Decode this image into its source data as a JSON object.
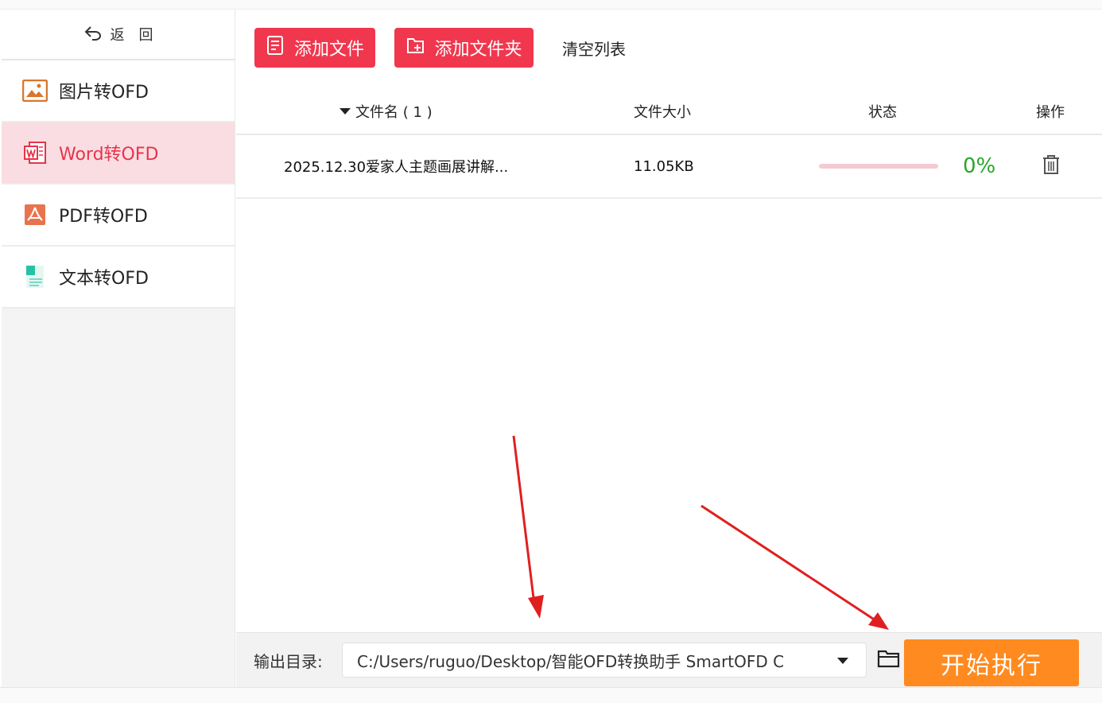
{
  "sidebar": {
    "back_label": "返　回",
    "items": [
      {
        "label": "图片转OFD",
        "icon": "image-icon",
        "active": false
      },
      {
        "label": "Word转OFD",
        "icon": "word-icon",
        "active": true
      },
      {
        "label": "PDF转OFD",
        "icon": "pdf-icon",
        "active": false
      },
      {
        "label": "文本转OFD",
        "icon": "text-doc-icon",
        "active": false
      }
    ]
  },
  "toolbar": {
    "add_file_label": "添加文件",
    "add_folder_label": "添加文件夹",
    "clear_list_label": "清空列表"
  },
  "table": {
    "headers": {
      "name": "文件名 ( 1 )",
      "size": "文件大小",
      "status": "状态",
      "operation": "操作"
    },
    "rows": [
      {
        "name": "2025.12.30爱家人主题画展讲解...",
        "size": "11.05KB",
        "progress": 0,
        "percent": "0%"
      }
    ]
  },
  "footer": {
    "output_label": "输出目录:",
    "output_path": "C:/Users/ruguo/Desktop/智能OFD转换助手 SmartOFD C",
    "start_label": "开始执行"
  },
  "colors": {
    "brand_red": "#f0374e",
    "active_bg": "#f9dde2",
    "start_orange": "#ff8a1f",
    "percent_green": "#2aa52a",
    "annotation_arrow": "#e02020"
  }
}
